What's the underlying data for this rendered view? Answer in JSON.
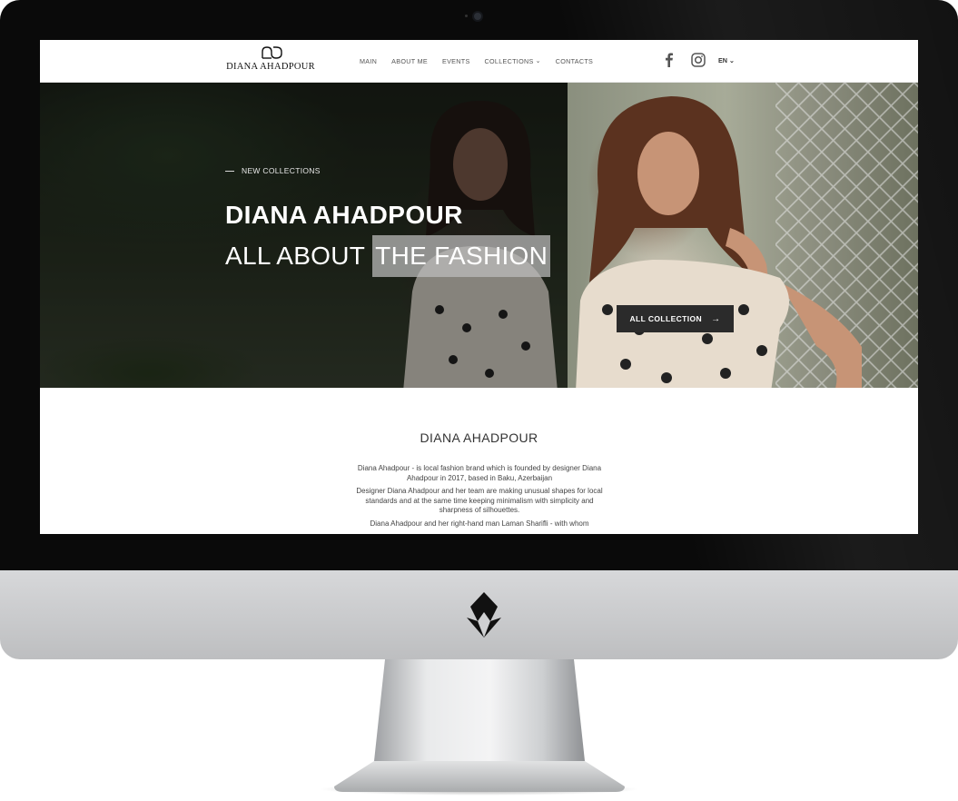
{
  "site": {
    "brand_name": "DIANA AHADPOUR",
    "nav": [
      {
        "label": "MAIN",
        "has_dropdown": false
      },
      {
        "label": "ABOUT ME",
        "has_dropdown": false
      },
      {
        "label": "EVENTS",
        "has_dropdown": false
      },
      {
        "label": "COLLECTIONS",
        "has_dropdown": true
      },
      {
        "label": "CONTACTS",
        "has_dropdown": false
      }
    ],
    "social_icons": [
      "facebook-icon",
      "instagram-icon"
    ],
    "language": "EN"
  },
  "hero": {
    "kicker": "NEW COLLECTIONS",
    "title": "DIANA AHADPOUR",
    "subtitle_plain": "ALL ABOUT",
    "subtitle_highlight": "THE FASHION",
    "cta_label": "ALL COLLECTION",
    "cta_arrow": "→"
  },
  "about": {
    "title": "DIANA AHADPOUR",
    "paragraphs": [
      "Diana Ahadpour - is local fashion brand which is founded by designer Diana Ahadpour in 2017, based in Baku, Azerbaijan",
      "Designer Diana Ahadpour and her team are making unusual shapes for local standards and at the same time keeping minimalism with simplicity and sharpness of silhouettes.",
      "Diana Ahadpour and her right-hand man Laman Sharifli - with whom"
    ]
  },
  "colors": {
    "bezel": "#0a0a0a",
    "chin": "#cfd0d2",
    "cta_background": "#2b2b2b",
    "highlight": "#bebebe"
  }
}
